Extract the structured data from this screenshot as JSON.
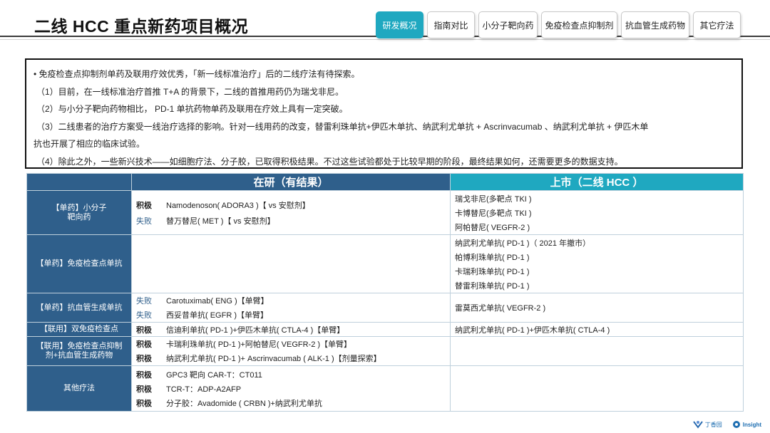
{
  "header": {
    "title": "二线 HCC 重点新药项目概况"
  },
  "tabs": [
    {
      "label": "研发概况",
      "active": true
    },
    {
      "label": "指南对比",
      "active": false
    },
    {
      "label": "小分子靶向药",
      "active": false
    },
    {
      "label": "免疫检查点抑制剂",
      "active": false
    },
    {
      "label": "抗血管生成药物",
      "active": false
    },
    {
      "label": "其它疗法",
      "active": false
    }
  ],
  "summary": {
    "line1": "•  免疫检查点抑制剂单药及联用疗效优秀，「新一线标准治疗」后的二线疗法有待探索。",
    "line2": "（1）目前，在一线标准治疗首推 T+A 的背景下，二线的首推用药仍为瑞戈非尼。",
    "line3": "（2）与小分子靶向药物相比， PD-1 单抗药物单药及联用在疗效上具有一定突破。",
    "line4": "（3）二线患者的治疗方案受一线治疗选择的影响。针对一线用药的改变，替雷利珠单抗+伊匹木单抗、纳武利尤单抗 + Ascrinvacumab 、纳武利尤单抗 + 伊匹木单",
    "line5": "抗也开展了相应的临床试验。",
    "line6": "（4）除此之外，一些新兴技术——如细胞疗法、分子胶，已取得积极结果。不过这些试验都处于比较早期的阶段，最终结果如何，还需要更多的数据支持。"
  },
  "table": {
    "header_mid": "在研（有结果）",
    "header_right": "上市（二线 HCC ）",
    "rows": [
      {
        "category": "【单药】小分子\n靶向药",
        "trials": [
          {
            "status": "积极",
            "drug": "Namodenoson( ADORA3 )【 vs 安慰剂】"
          },
          {
            "status": "失败",
            "drug": "替万替尼( MET )【 vs 安慰剂】"
          }
        ],
        "approved": [
          "瑞戈非尼(多靶点 TKI )",
          "卡博替尼(多靶点 TKI )",
          "阿帕替尼( VEGFR-2 )"
        ]
      },
      {
        "category": "【单药】免疫检查点单抗",
        "trials": [],
        "approved": [
          "纳武利尤单抗( PD-1 )（ 2021 年撤市）",
          "帕博利珠单抗( PD-1 )",
          "卡瑞利珠单抗( PD-1 )",
          "替雷利珠单抗( PD-1 )"
        ]
      },
      {
        "category": "【单药】抗血管生成单抗",
        "trials": [
          {
            "status": "失败",
            "drug": "Carotuximab( ENG )【单臂】"
          },
          {
            "status": "失败",
            "drug": "西妥昔单抗( EGFR )【单臂】"
          }
        ],
        "approved": [
          "雷莫西尤单抗( VEGFR-2 )"
        ]
      },
      {
        "category": "【联用】双免疫检查点",
        "trials": [
          {
            "status": "积极",
            "drug": "信迪利单抗( PD-1 )+伊匹木单抗( CTLA-4 )【单臂】"
          }
        ],
        "approved": [
          "纳武利尤单抗( PD-1 )+伊匹木单抗( CTLA-4 )"
        ]
      },
      {
        "category": "【联用】免疫检查点抑制\n剂+抗血管生成药物",
        "trials": [
          {
            "status": "积极",
            "drug": "卡瑞利珠单抗( PD-1 )+阿帕替尼( VEGFR-2 )【单臂】"
          },
          {
            "status": "积极",
            "drug": "纳武利尤单抗( PD-1 )+ Ascrinvacumab ( ALK-1 )【剂量探索】"
          }
        ],
        "approved": []
      },
      {
        "category": "其他疗法",
        "trials": [
          {
            "status": "积极",
            "drug": "GPC3 靶向 CAR-T：CT011"
          },
          {
            "status": "积极",
            "drug": "TCR-T：ADP-A2AFP"
          },
          {
            "status": "积极",
            "drug": "分子胶：Avadomide ( CRBN )+纳武利尤单抗"
          }
        ],
        "approved": []
      }
    ]
  },
  "footer": {
    "logo1": "丁香园",
    "logo2": "Insight"
  },
  "colors": {
    "navy": "#2f5f8b",
    "teal": "#1fa8c0",
    "fail_text": "#2f5f8b"
  },
  "icons": {
    "logo1": "dxy-logo-icon",
    "logo2": "insight-logo-icon"
  }
}
